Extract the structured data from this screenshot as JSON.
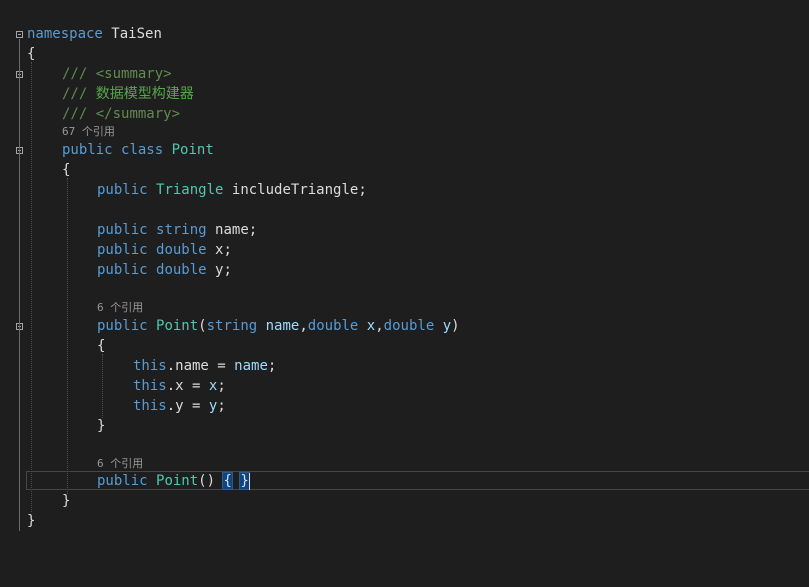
{
  "editor": {
    "top_fragment": "[  ----  --  --------  ----- ]",
    "ns_kw": "namespace",
    "ns_name": "TaiSen",
    "open_brace": "{",
    "close_brace": "}",
    "doc_line1_slashes": "///",
    "doc_line1_tag": "<summary>",
    "doc_line2_slashes": "///",
    "doc_line2_text": "数据模型构建器",
    "doc_line3_slashes": "///",
    "doc_line3_tag": "</summary>",
    "class_refs": "67 个引用",
    "class_kw1": "public",
    "class_kw2": "class",
    "class_name": "Point",
    "field1_kw": "public",
    "field1_type": "Triangle",
    "field1_rest": "includeTriangle;",
    "field2_kw1": "public",
    "field2_kw2": "string",
    "field2_rest": "name;",
    "field3_kw1": "public",
    "field3_kw2": "double",
    "field3_rest": "x;",
    "field4_kw1": "public",
    "field4_kw2": "double",
    "field4_rest": "y;",
    "ctor1_refs": "6 个引用",
    "ctor1_kw": "public",
    "ctor1_name": "Point",
    "ctor1_p1type": "string",
    "ctor1_p1": "name",
    "ctor1_p2type": "double",
    "ctor1_p2": "x",
    "ctor1_p3type": "double",
    "ctor1_p3": "y",
    "stmt1_this": "this",
    "stmt1_field": ".name = ",
    "stmt1_val": "name",
    "stmt2_this": "this",
    "stmt2_field": ".x = ",
    "stmt2_val": "x",
    "stmt3_this": "this",
    "stmt3_field": ".y = ",
    "stmt3_val": "y",
    "ctor2_refs": "6 个引用",
    "ctor2_kw": "public",
    "ctor2_name": "Point",
    "ctor2_parens": "()",
    "ctor2_open": "{",
    "ctor2_close": "}"
  },
  "colors": {
    "background": "#1e1e1e",
    "keyword": "#569cd6",
    "type": "#4ec9b0",
    "comment": "#57a64a",
    "parameter": "#9cdcfe",
    "plain": "#dcdcdc",
    "codelens": "#999999"
  }
}
